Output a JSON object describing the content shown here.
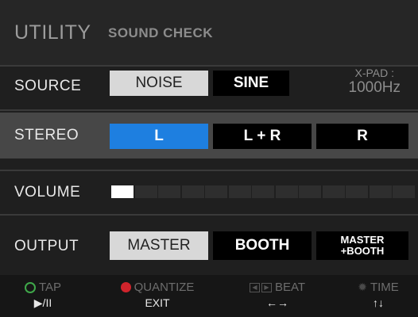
{
  "title": {
    "main": "UTILITY",
    "sub": "SOUND CHECK"
  },
  "source": {
    "label": "SOURCE",
    "options": [
      "NOISE",
      "SINE"
    ],
    "selected": "NOISE",
    "xpad_label": "X-PAD :",
    "xpad_value": "1000Hz"
  },
  "stereo": {
    "label": "STEREO",
    "options": [
      "L",
      "L + R",
      "R"
    ],
    "selected": "L"
  },
  "volume": {
    "label": "VOLUME",
    "level_segments": 1,
    "total_segments": 13
  },
  "output": {
    "label": "OUTPUT",
    "options": [
      "MASTER",
      "BOOTH"
    ],
    "option3_line1": "MASTER",
    "option3_line2": "+BOOTH",
    "selected": "MASTER"
  },
  "footer": {
    "tap": {
      "top": "TAP",
      "bottom": "▶/II",
      "icon": "green-circle-icon"
    },
    "quantize": {
      "top": "QUANTIZE",
      "bottom": "EXIT",
      "icon": "red-dot-icon"
    },
    "beat": {
      "top": "BEAT",
      "bottom": "←→",
      "icon": "beat-arrows-icon"
    },
    "time": {
      "top": "TIME",
      "bottom": "↑↓",
      "icon": "gear-icon"
    }
  },
  "colors": {
    "accent_blue": "#1e7fe0",
    "selected_gray": "#d8d8d8",
    "tap_green": "#3fa84a",
    "quantize_red": "#d0242c"
  }
}
